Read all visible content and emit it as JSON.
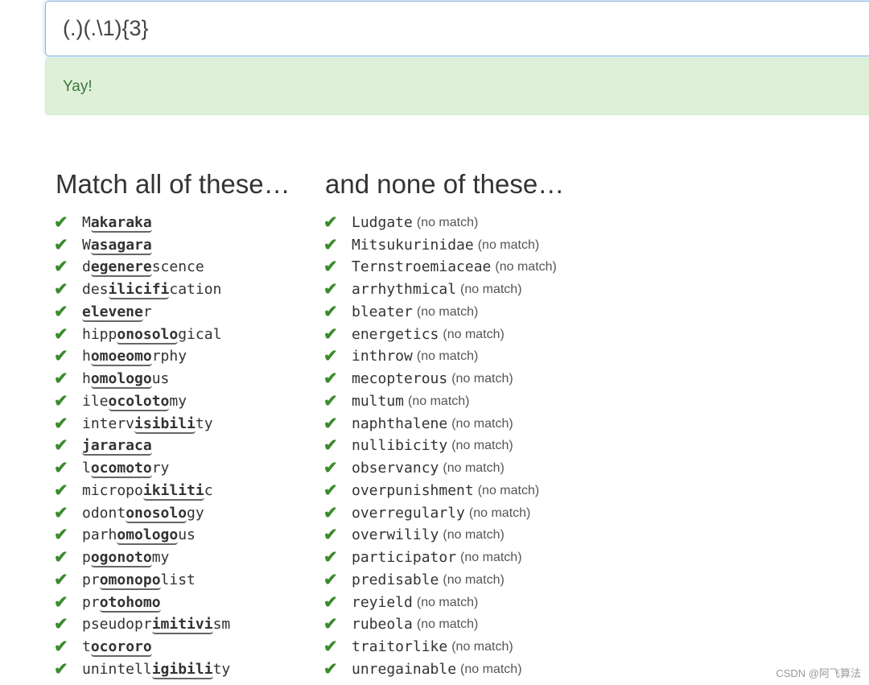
{
  "regex": {
    "value": "(.)(.\\1){3}"
  },
  "status": {
    "text": "Yay!"
  },
  "match_heading": "Match all of these…",
  "nonmatch_heading": "and none of these…",
  "check_glyph": "✔",
  "match_words": [
    {
      "pre": "M",
      "hl": "akaraka",
      "post": ""
    },
    {
      "pre": "W",
      "hl": "asagara",
      "post": ""
    },
    {
      "pre": "d",
      "hl": "egenere",
      "post": "scence"
    },
    {
      "pre": "des",
      "hl": "ilicifi",
      "post": "cation"
    },
    {
      "pre": "",
      "hl": "elevene",
      "post": "r"
    },
    {
      "pre": "hipp",
      "hl": "onosolo",
      "post": "gical"
    },
    {
      "pre": "h",
      "hl": "omoeomo",
      "post": "rphy"
    },
    {
      "pre": "h",
      "hl": "omologo",
      "post": "us"
    },
    {
      "pre": "ile",
      "hl": "ocoloto",
      "post": "my"
    },
    {
      "pre": "interv",
      "hl": "isibili",
      "post": "ty"
    },
    {
      "pre": "",
      "hl": "jararaca",
      "post": ""
    },
    {
      "pre": "l",
      "hl": "ocomoto",
      "post": "ry"
    },
    {
      "pre": "micropo",
      "hl": "ikiliti",
      "post": "c"
    },
    {
      "pre": "odont",
      "hl": "onosolo",
      "post": "gy"
    },
    {
      "pre": "parh",
      "hl": "omologo",
      "post": "us"
    },
    {
      "pre": "p",
      "hl": "ogonoto",
      "post": "my"
    },
    {
      "pre": "pr",
      "hl": "omonopo",
      "post": "list"
    },
    {
      "pre": "pr",
      "hl": "otohomo",
      "post": ""
    },
    {
      "pre": "pseudopr",
      "hl": "imitivi",
      "post": "sm"
    },
    {
      "pre": "t",
      "hl": "ocororo",
      "post": ""
    },
    {
      "pre": "unintell",
      "hl": "igibili",
      "post": "ty"
    }
  ],
  "nonmatch_note": "(no match)",
  "nonmatch_words": [
    "Ludgate",
    "Mitsukurinidae",
    "Ternstroemiaceae",
    "arrhythmical",
    "bleater",
    "energetics",
    "inthrow",
    "mecopterous",
    "multum",
    "naphthalene",
    "nullibicity",
    "observancy",
    "overpunishment",
    "overregularly",
    "overwilily",
    "participator",
    "predisable",
    "reyield",
    "rubeola",
    "traitorlike",
    "unregainable"
  ],
  "watermark": "CSDN @阿飞算法",
  "colors": {
    "check": "#3c8a2e",
    "success_bg": "#dff0d8",
    "success_text": "#3c763d",
    "input_focus": "#66afe9"
  }
}
